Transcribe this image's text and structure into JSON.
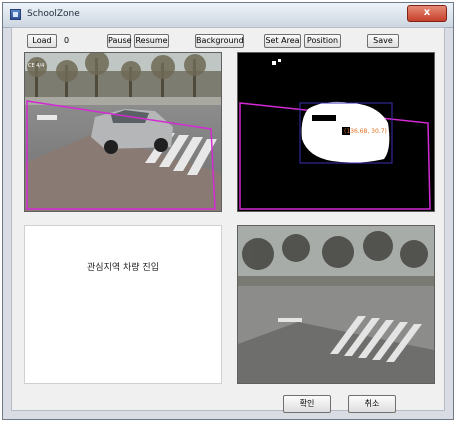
{
  "window": {
    "title": "SchoolZone",
    "close_label": "x"
  },
  "toolbar": {
    "load_label": "Load",
    "counter_value": "0",
    "pause_label": "Pause",
    "resume_label": "Resume",
    "background_label": "Background",
    "set_area_label": "Set Area",
    "position_label": "Position",
    "save_label": "Save"
  },
  "panels": {
    "camera_overlay": "CE 4/4",
    "detection_coords": "(136.68, 30.7)",
    "status_message": "관심지역 차량 진입"
  },
  "dialog": {
    "ok_label": "확인",
    "cancel_label": "취소"
  },
  "colors": {
    "roi_outline": "#d42ad4",
    "detection_box": "#3a2fb0",
    "coords_text": "#e07020",
    "titlebar": "#cdd6e1",
    "close_button": "#c5402a"
  }
}
